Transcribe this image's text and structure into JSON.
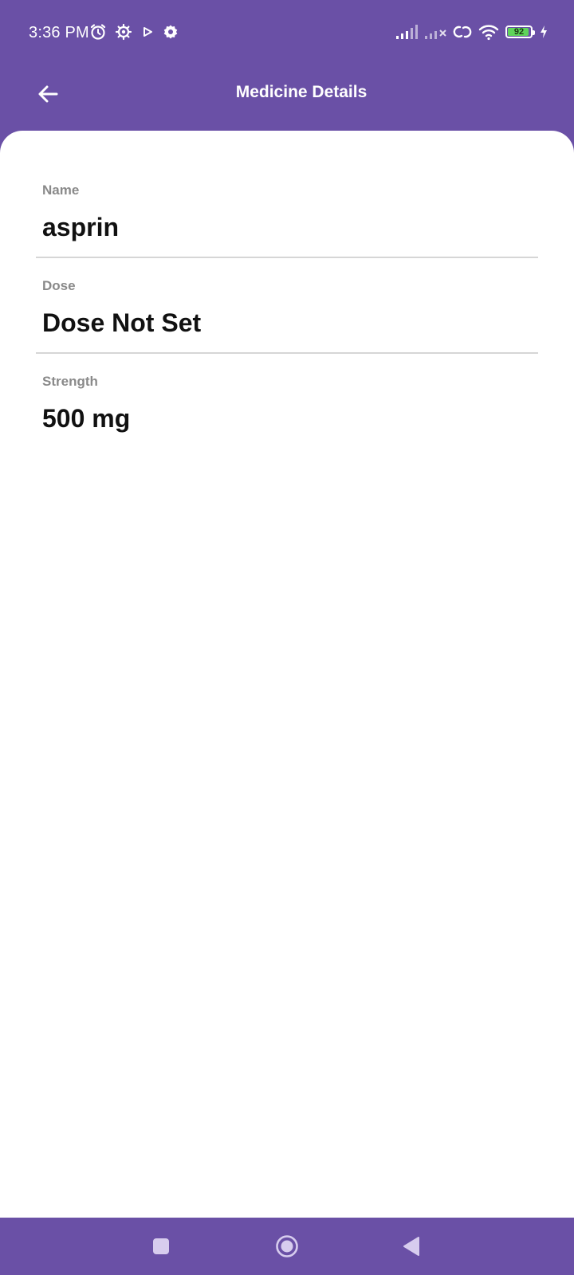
{
  "status_bar": {
    "time": "3:36 PM",
    "battery_level": "92",
    "left_icons": [
      "alarm-icon",
      "settings-gear-icon",
      "play-icon",
      "gear-icon"
    ],
    "right_icons": [
      "signal-icon",
      "signal-no-service-icon",
      "link-icon",
      "wifi-icon",
      "battery-icon",
      "charging-icon"
    ]
  },
  "header": {
    "title": "Medicine Details",
    "back_icon": "arrow-left-icon"
  },
  "details": [
    {
      "label": "Name",
      "value": "asprin"
    },
    {
      "label": "Dose",
      "value": "Dose Not Set"
    },
    {
      "label": "Strength",
      "value": "500 mg"
    }
  ],
  "nav_bar": {
    "buttons": [
      "recents-square-icon",
      "home-circle-icon",
      "back-triangle-icon"
    ]
  },
  "colors": {
    "primary": "#6a50a6",
    "label": "#8a8a8a",
    "value": "#111111",
    "divider": "#d6d6d6",
    "battery": "#5fd45a"
  }
}
